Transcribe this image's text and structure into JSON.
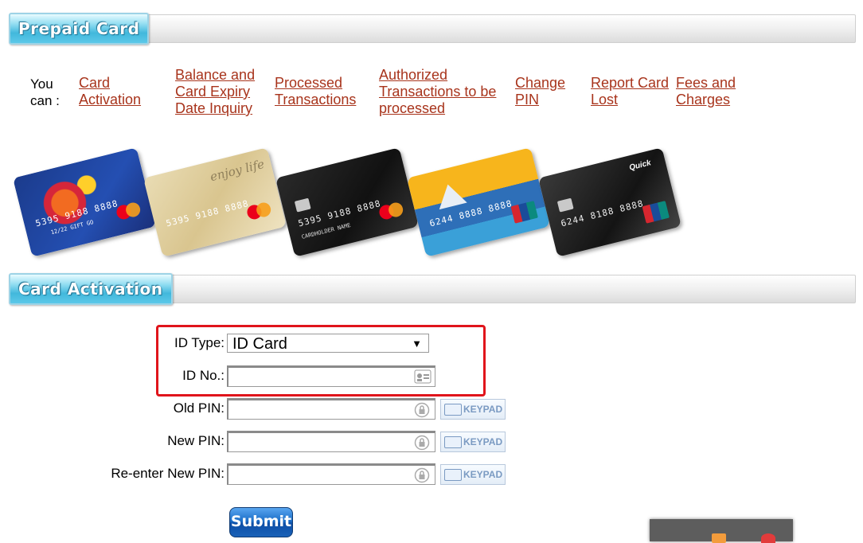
{
  "sections": {
    "prepaid_card": "Prepaid Card",
    "card_activation": "Card Activation"
  },
  "you_can": {
    "label_line1": "You",
    "label_line2": "can :",
    "links": [
      {
        "line1": "Card",
        "line2": "Activation",
        "line3": ""
      },
      {
        "line1": "Balance and",
        "line2": "Card Expiry",
        "line3": "Date Inquiry"
      },
      {
        "line1": "Processed",
        "line2": "Transactions",
        "line3": ""
      },
      {
        "line1": "Authorized",
        "line2": "Transactions to be",
        "line3": "processed"
      },
      {
        "line1": "Change",
        "line2": "PIN",
        "line3": ""
      },
      {
        "line1": "Report Card",
        "line2": "Lost",
        "line3": ""
      },
      {
        "line1": "Fees and",
        "line2": "Charges",
        "line3": ""
      }
    ]
  },
  "cards": [
    {
      "number": "5395 9188 8888",
      "brand": "mastercard",
      "extra": "12/22 GIFT GO"
    },
    {
      "number": "5395 9188 8888",
      "brand": "mastercard",
      "extra": "enjoy life"
    },
    {
      "number": "5395 9188 8888",
      "brand": "mastercard",
      "extra": "CARDHOLDER NAME"
    },
    {
      "number": "6244 8888 8888",
      "brand": "UnionPay",
      "extra": ""
    },
    {
      "number": "6244 8188 8888",
      "brand": "UnionPay",
      "extra": "Quick"
    }
  ],
  "form": {
    "id_type_label": "ID Type:",
    "id_type_value": "ID Card",
    "id_no_label": "ID No.:",
    "old_pin_label": "Old PIN:",
    "new_pin_label": "New PIN:",
    "reenter_pin_label": "Re-enter New PIN:",
    "keypad_label": "KEYPAD",
    "submit_label": "Submit"
  },
  "colors": {
    "link": "#a8341c",
    "highlight_border": "#e0141b",
    "banner_blue": "#42b8dc"
  }
}
